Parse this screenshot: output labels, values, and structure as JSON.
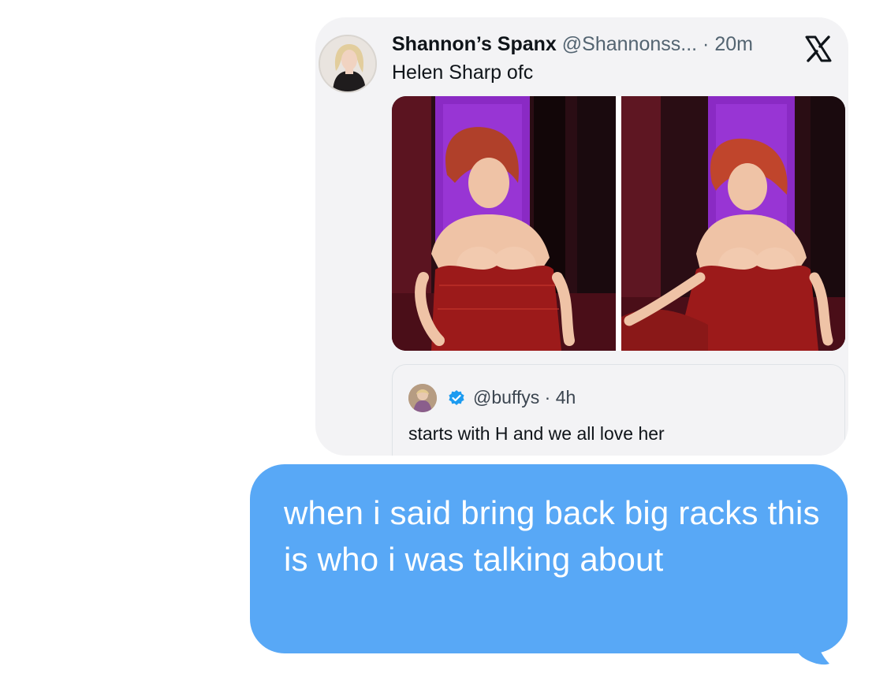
{
  "tweet": {
    "author_name": "Shannon’s Spanx",
    "author_handle": "@Shannonss...",
    "time": "20m",
    "text": "Helen Sharp ofc",
    "avatar_icon": "profile-avatar",
    "platform_icon": "x-logo-icon",
    "media": [
      {
        "description_icon": "photo-performer-left"
      },
      {
        "description_icon": "photo-performer-right"
      }
    ],
    "quote": {
      "handle": "@buffys",
      "time": "4h",
      "text": "starts with H and we all love her",
      "verified_icon": "verified-badge-icon",
      "verified_color": "#1d9bf0"
    }
  },
  "message": {
    "text": "when i said bring back big racks this is who i was talking about",
    "bubble_color": "#58a8f6"
  }
}
